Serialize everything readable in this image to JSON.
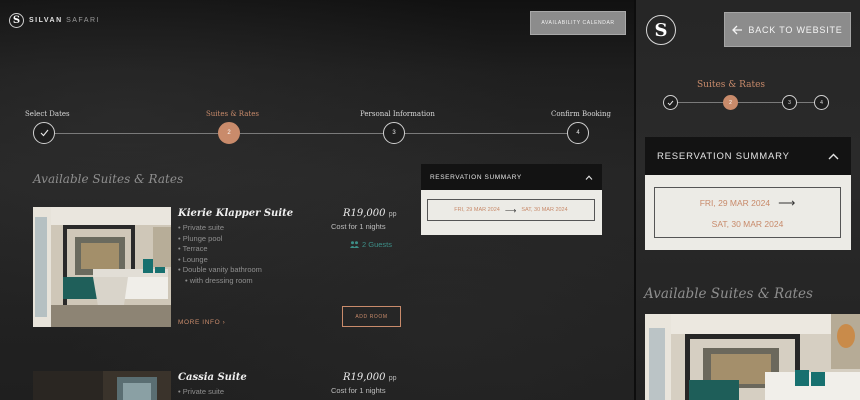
{
  "brand": {
    "name_bold": "SILVAN",
    "name_light": "SAFARI",
    "mark": "S"
  },
  "header": {
    "availability_calendar": "AVAILABILITY CALENDAR"
  },
  "steps": [
    {
      "label": "Select Dates",
      "number": "1",
      "state": "completed"
    },
    {
      "label": "Suites & Rates",
      "number": "2",
      "state": "active"
    },
    {
      "label": "Personal Information",
      "number": "3",
      "state": "pending"
    },
    {
      "label": "Confirm Booking",
      "number": "4",
      "state": "pending"
    }
  ],
  "main": {
    "heading": "Available Suites & Rates"
  },
  "rooms": [
    {
      "name": "Kierie Klapper Suite",
      "features": [
        "Private suite",
        "Plunge pool",
        "Terrace",
        "Lounge",
        "Double vanity bathroom",
        "with dressing room"
      ],
      "price": "R19,000",
      "price_unit": "pp",
      "cost": "Cost for 1 nights",
      "guests": "2 Guests",
      "more_info": "MORE INFO ›",
      "add_room": "ADD ROOM"
    },
    {
      "name": "Cassia Suite",
      "features": [
        "Private suite"
      ],
      "price": "R19,000",
      "price_unit": "pp",
      "cost": "Cost for 1 nights"
    }
  ],
  "reservation": {
    "title": "RESERVATION SUMMARY",
    "check_in": "FRI, 29 MAR 2024",
    "check_out": "SAT, 30 MAR 2024",
    "arrow": "⟶"
  },
  "side": {
    "back_label": "BACK TO WEBSITE",
    "step_label": "Suites & Rates",
    "heading": "Available Suites & Rates"
  },
  "colors": {
    "accent": "#c98b6b",
    "teal": "#3d8f88",
    "panel_light": "#ecebe6"
  }
}
